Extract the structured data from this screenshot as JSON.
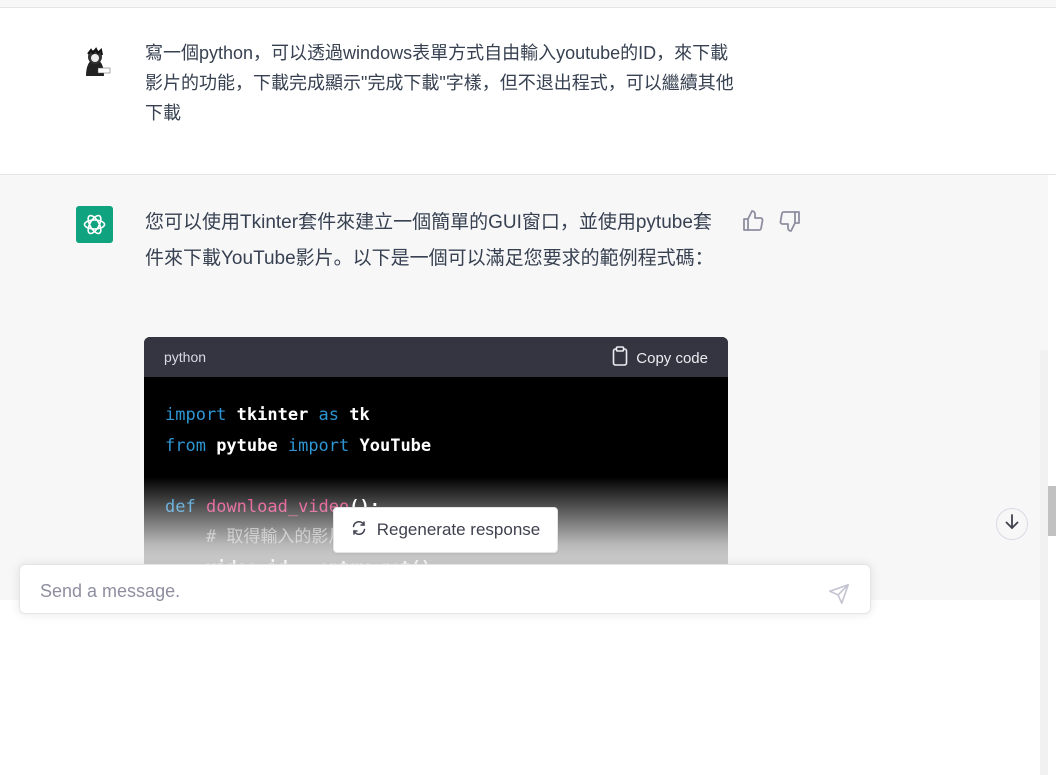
{
  "user_message": {
    "text": "寫一個python，可以透過windows表單方式自由輸入youtube的ID，來下載影片的功能，下載完成顯示\"完成下載\"字樣，但不退出程式，可以繼續其他下載"
  },
  "assistant_message": {
    "text": "您可以使用Tkinter套件來建立一個簡單的GUI窗口，並使用pytube套件來下載YouTube影片。以下是一個可以滿足您要求的範例程式碼："
  },
  "code_block": {
    "language": "python",
    "copy_label": "Copy code",
    "lines": [
      [
        {
          "t": "import",
          "c": "kw"
        },
        {
          "t": " tkinter "
        },
        {
          "t": "as",
          "c": "kw"
        },
        {
          "t": " tk"
        }
      ],
      [
        {
          "t": "from",
          "c": "kw"
        },
        {
          "t": " pytube "
        },
        {
          "t": "import",
          "c": "kw"
        },
        {
          "t": " YouTube"
        }
      ],
      [
        {
          "t": ""
        }
      ],
      [
        {
          "t": "def",
          "c": "kw"
        },
        {
          "t": " "
        },
        {
          "t": "download_video",
          "c": "fn"
        },
        {
          "t": "():"
        }
      ],
      [
        {
          "t": "    "
        },
        {
          "t": "# 取得輸入的影片ID",
          "c": "cm"
        }
      ],
      [
        {
          "t": "    video_id = entry.get()"
        }
      ]
    ]
  },
  "regenerate_label": "Regenerate response",
  "composer": {
    "placeholder": "Send a message."
  },
  "icons": {
    "thumbs_up": "thumbs-up-icon",
    "thumbs_down": "thumbs-down-icon",
    "copy": "clipboard-icon",
    "regenerate": "refresh-icon",
    "scroll_down": "arrow-down-icon",
    "send": "send-icon"
  },
  "colors": {
    "accent": "#10a37f",
    "code_keyword": "#2e95d3",
    "code_function": "#df3079"
  }
}
